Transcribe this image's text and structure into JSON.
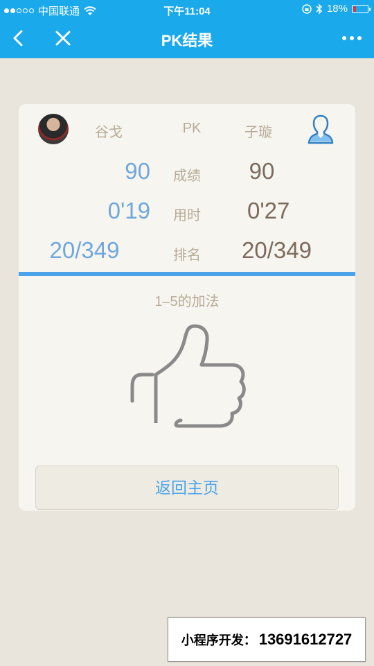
{
  "status_bar": {
    "carrier": "中国联通",
    "time": "下午11:04",
    "battery": "18%",
    "battery_level": 0.18,
    "battery_color": "#e33333"
  },
  "nav": {
    "title": "PK结果",
    "back_icon": "chevron-left-icon",
    "close_icon": "close-icon",
    "more_icon": "more-horizontal-icon",
    "bg_color": "#1aa9ea"
  },
  "pk": {
    "left_name": "谷戈",
    "vs_label": "PK",
    "right_name": "子璇",
    "rows": [
      {
        "label": "成绩",
        "left": "90",
        "right": "90"
      },
      {
        "label": "用时",
        "left": "0'19",
        "right": "0'27"
      },
      {
        "label": "排名",
        "left": "20/349",
        "right": "20/349"
      }
    ],
    "accent_color": "#4ba3ea"
  },
  "result": {
    "subject": "1–5的加法",
    "icon": "thumbs-up-icon"
  },
  "actions": {
    "home_label": "返回主页"
  },
  "footer": {
    "label": "小程序开发：",
    "phone": "13691612727"
  }
}
